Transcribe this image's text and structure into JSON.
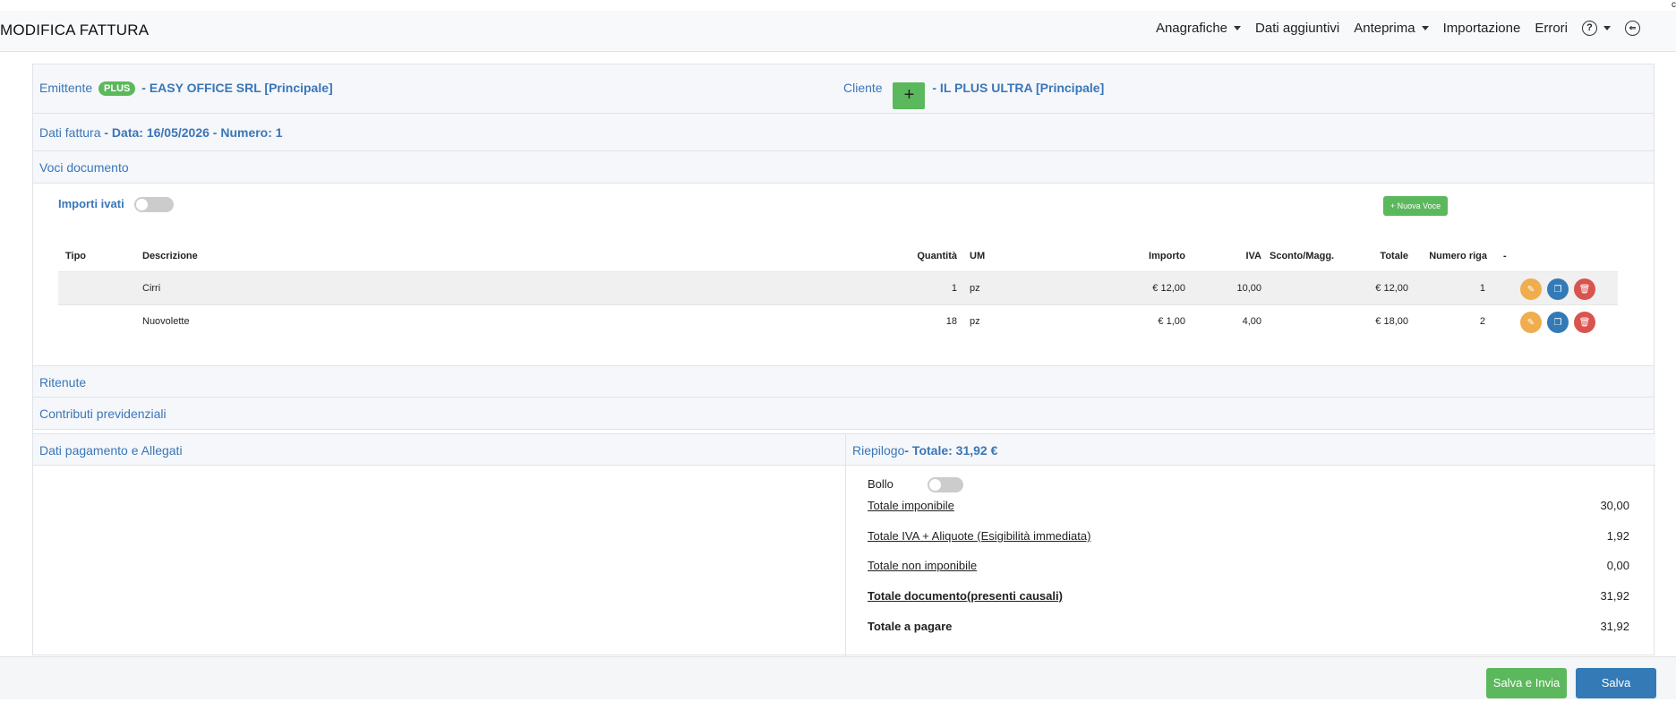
{
  "header": {
    "title": "MODIFICA FATTURA",
    "nav": [
      {
        "label": "Anagrafiche",
        "dropdown": true
      },
      {
        "label": "Dati aggiuntivi",
        "dropdown": false
      },
      {
        "label": "Anteprima",
        "dropdown": true
      },
      {
        "label": "Importazione",
        "dropdown": false
      },
      {
        "label": "Errori",
        "dropdown": false
      }
    ],
    "help_icon_glyph": "?",
    "back_icon_glyph": "⇐"
  },
  "emittente": {
    "label": "Emittente",
    "badge": "PLUS",
    "name": "- EASY OFFICE SRL [Principale]"
  },
  "cliente": {
    "label": "Cliente",
    "add_glyph": "+",
    "name": "- IL PLUS ULTRA [Principale]"
  },
  "dati_fattura": {
    "label": "Dati fattura",
    "value": "- Data: 16/05/2026 - Numero: 1"
  },
  "voci": {
    "label": "Voci documento",
    "importi_ivati_label": "Importi ivati",
    "importi_ivati_on": false,
    "nuova_voce_label": "+ Nuova Voce",
    "columns": {
      "tipo": "Tipo",
      "descrizione": "Descrizione",
      "quantita": "Quantità",
      "um": "UM",
      "importo": "Importo",
      "iva": "IVA",
      "sconto": "Sconto/Magg.",
      "totale": "Totale",
      "numero_riga": "Numero riga",
      "azioni": "-"
    },
    "rows": [
      {
        "tipo": "",
        "descrizione": "Cirri",
        "quantita": "1",
        "um": "pz",
        "importo": "€ 12,00",
        "iva": "10,00",
        "sconto": "",
        "totale": "€ 12,00",
        "numero_riga": "1"
      },
      {
        "tipo": "",
        "descrizione": "Nuovolette",
        "quantita": "18",
        "um": "pz",
        "importo": "€ 1,00",
        "iva": "4,00",
        "sconto": "",
        "totale": "€ 18,00",
        "numero_riga": "2"
      }
    ]
  },
  "ritenute": {
    "label": "Ritenute"
  },
  "contributi": {
    "label": "Contributi previdenziali"
  },
  "pagamento": {
    "label": "Dati pagamento e Allegati"
  },
  "riepilogo": {
    "label": "Riepilogo",
    "totale_text": "- Totale: 31,92 €",
    "bollo_label": "Bollo",
    "bollo_on": false,
    "rows": [
      {
        "label": "Totale imponibile",
        "value": "30,00"
      },
      {
        "label": "Totale IVA + Aliquote (Esigibilità immediata)",
        "value": "1,92"
      },
      {
        "label": "Totale non imponibile",
        "value": "0,00"
      },
      {
        "label": "Totale documento(presenti causali)",
        "value": "31,92"
      },
      {
        "label": "Totale a pagare",
        "value": "31,92"
      }
    ]
  },
  "footer": {
    "salva_invia": "Salva e Invia",
    "salva": "Salva"
  },
  "colors": {
    "accent_blue": "#3a76b8",
    "green": "#5cb85c",
    "primary_blue": "#337ab7",
    "warning": "#f0ad4e",
    "danger": "#d9534f"
  }
}
